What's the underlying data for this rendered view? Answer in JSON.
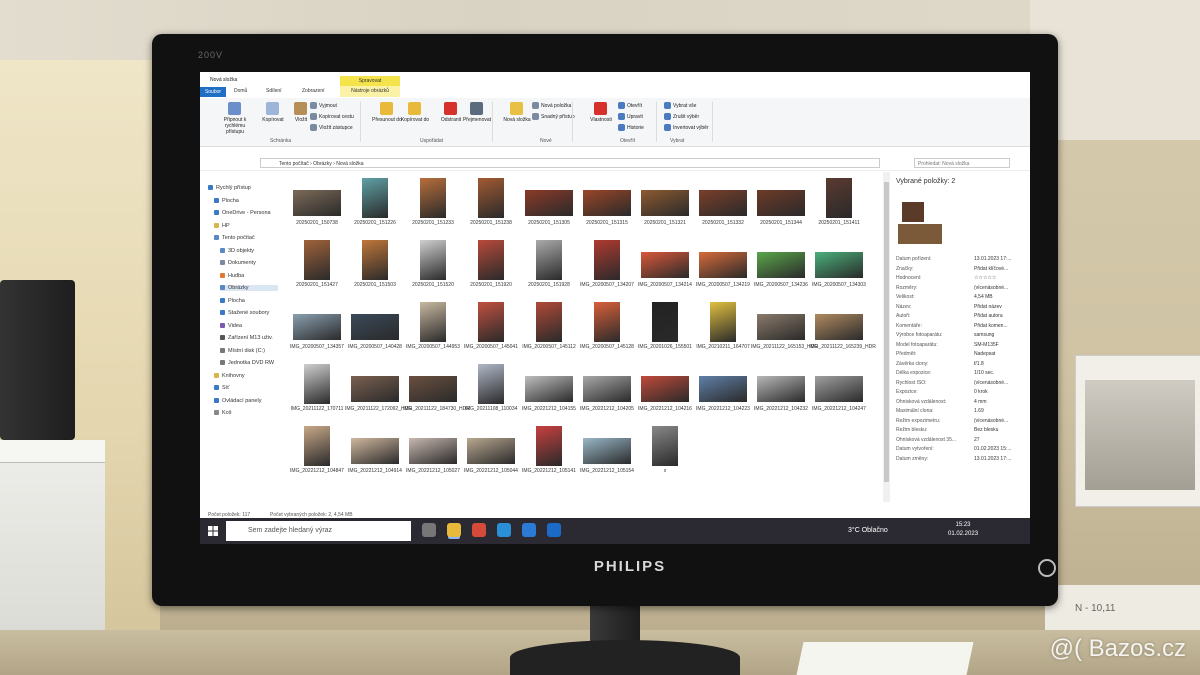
{
  "window": {
    "title": "Nová složka",
    "tools_header": "Spravovat",
    "tools_tab": "Nástroje obrázků"
  },
  "tabs": [
    "Soubor",
    "Domů",
    "Sdílení",
    "Zobrazení"
  ],
  "ribbon": {
    "buttons": [
      {
        "label": "Připnout k rychlému přístupu",
        "color": "#6a8fc9"
      },
      {
        "label": "Kopírovat",
        "color": "#9cb5d8"
      },
      {
        "label": "Vložit",
        "color": "#b58e58"
      },
      {
        "label": "Vyjmout",
        "color": "#7a8aa0"
      },
      {
        "label": "Kopírovat cestu",
        "color": "#7a8aa0"
      },
      {
        "label": "Vložit zástupce",
        "color": "#7a8aa0"
      },
      {
        "label": "Přesunout do",
        "color": "#e8b93a"
      },
      {
        "label": "Kopírovat do",
        "color": "#e8b93a"
      },
      {
        "label": "Odstranit",
        "color": "#d6322b"
      },
      {
        "label": "Přejmenovat",
        "color": "#5b6b7e"
      },
      {
        "label": "Nová složka",
        "color": "#e8c043"
      },
      {
        "label": "Nová položka",
        "color": "#7a8aa0"
      },
      {
        "label": "Snadný přístup",
        "color": "#7a8aa0"
      },
      {
        "label": "Vlastnosti",
        "color": "#d6322b"
      },
      {
        "label": "Otevřít",
        "color": "#4a7ac0"
      },
      {
        "label": "Upravit",
        "color": "#4a7ac0"
      },
      {
        "label": "Historie",
        "color": "#4a7ac0"
      },
      {
        "label": "Vybrat vše",
        "color": "#4a7ac0"
      },
      {
        "label": "Zrušit výběr",
        "color": "#4a7ac0"
      },
      {
        "label": "Invertovat výběr",
        "color": "#4a7ac0"
      }
    ],
    "groups": [
      "Schránka",
      "Uspořádat",
      "Nové",
      "Otevřít",
      "Vybrat"
    ]
  },
  "address": {
    "path": "Tento počítač  ›  Obrázky  ›  Nová složka",
    "search_placeholder": "Prohledat: Nová složka"
  },
  "nav": [
    {
      "label": "Rychlý přístup",
      "color": "#3a78c8"
    },
    {
      "label": "Plocha",
      "color": "#3a78c8"
    },
    {
      "label": "OneDrive - Persona",
      "color": "#3a78c8"
    },
    {
      "label": "HP",
      "color": "#d9b44a"
    },
    {
      "label": "Tento počítač",
      "color": "#5a88c4"
    },
    {
      "label": "3D objekty",
      "color": "#5a88c4"
    },
    {
      "label": "Dokumenty",
      "color": "#7a8aa0"
    },
    {
      "label": "Hudba",
      "color": "#e07a30"
    },
    {
      "label": "Obrázky",
      "color": "#5a88c4"
    },
    {
      "label": "Plocha",
      "color": "#3a78c8"
    },
    {
      "label": "Stažené soubory",
      "color": "#3a78c8"
    },
    {
      "label": "Videa",
      "color": "#7a5ab0"
    },
    {
      "label": "Zařízení M13 uživ.",
      "color": "#555555"
    },
    {
      "label": "Místní disk (C:)",
      "color": "#777777"
    },
    {
      "label": "Jednotka DVD RW",
      "color": "#777777"
    },
    {
      "label": "Knihovny",
      "color": "#d9b44a"
    },
    {
      "label": "Síť",
      "color": "#3a78c8"
    },
    {
      "label": "Ovládací panely",
      "color": "#3a78c8"
    },
    {
      "label": "Koš",
      "color": "#888888"
    }
  ],
  "files": [
    {
      "name": "20250201_150738",
      "color": "#7c6a58",
      "wide": true
    },
    {
      "name": "20250201_151226",
      "color": "#5fa1a6",
      "wide": false
    },
    {
      "name": "20250201_151233",
      "color": "#b86e3c",
      "wide": false
    },
    {
      "name": "20250201_151238",
      "color": "#a25a32",
      "wide": false
    },
    {
      "name": "20250201_151305",
      "color": "#8b3a28",
      "wide": true
    },
    {
      "name": "20250201_151315",
      "color": "#9a4628",
      "wide": true
    },
    {
      "name": "20250201_151321",
      "color": "#8d5a30",
      "wide": true
    },
    {
      "name": "20250201_151332",
      "color": "#7a3f2a",
      "wide": true
    },
    {
      "name": "20250201_151344",
      "color": "#6e3a28",
      "wide": true
    },
    {
      "name": "20250201_151411",
      "color": "#5a3a30",
      "wide": false
    },
    {
      "name": "20250201_151427",
      "color": "#a0623a",
      "wide": false
    },
    {
      "name": "20250201_151503",
      "color": "#c0763a",
      "wide": false
    },
    {
      "name": "20250201_151520",
      "color": "#cfcfcf",
      "wide": false
    },
    {
      "name": "20250201_151920",
      "color": "#b84a3a",
      "wide": false
    },
    {
      "name": "20250201_151928",
      "color": "#aaaaaa",
      "wide": false
    },
    {
      "name": "IMG_20200507_134207",
      "color": "#b03a30",
      "wide": false
    },
    {
      "name": "IMG_20200507_134214",
      "color": "#d9583a",
      "wide": true
    },
    {
      "name": "IMG_20200507_134219",
      "color": "#d66a3a",
      "wide": true
    },
    {
      "name": "IMG_20200507_134236",
      "color": "#5aa64a",
      "wide": true
    },
    {
      "name": "IMG_20200507_134303",
      "color": "#4ab07a",
      "wide": true
    },
    {
      "name": "IMG_20200507_134357",
      "color": "#8aa0b0",
      "wide": true
    },
    {
      "name": "IMG_20200507_140428",
      "color": "#3a4a5a",
      "wide": true
    },
    {
      "name": "IMG_20200507_144953",
      "color": "#c8b8a0",
      "wide": false
    },
    {
      "name": "IMG_20200507_145041",
      "color": "#c05040",
      "wide": false
    },
    {
      "name": "IMG_20200507_145112",
      "color": "#b04a38",
      "wide": false
    },
    {
      "name": "IMG_20200507_145128",
      "color": "#d8603a",
      "wide": false
    },
    {
      "name": "IMG_20201026_155501",
      "color": "#222222",
      "wide": false
    },
    {
      "name": "IMG_20210211_164707",
      "color": "#e0c040",
      "wide": false
    },
    {
      "name": "IMG_20211122_165153_HDR",
      "color": "#8a7a6a",
      "wide": true
    },
    {
      "name": "IMG_20211122_165239_HDR",
      "color": "#b08a60",
      "wide": true
    },
    {
      "name": "IMG_20211122_170711",
      "color": "#cfcfcf",
      "wide": false
    },
    {
      "name": "IMG_20211122_172092_HDR",
      "color": "#7a6050",
      "wide": true
    },
    {
      "name": "IMG_20211122_184730_HDR",
      "color": "#6a5040",
      "wide": true
    },
    {
      "name": "IMG_20211108_110034",
      "color": "#b0b8c8",
      "wide": false
    },
    {
      "name": "IMG_20221212_104155",
      "color": "#bfbfbf",
      "wide": true
    },
    {
      "name": "IMG_20221212_104205",
      "color": "#a8a8a8",
      "wide": true
    },
    {
      "name": "IMG_20221212_104216",
      "color": "#c04a3a",
      "wide": true
    },
    {
      "name": "IMG_20221212_104223",
      "color": "#6080a8",
      "wide": true
    },
    {
      "name": "IMG_20221212_104232",
      "color": "#b8b8b8",
      "wide": true
    },
    {
      "name": "IMG_20221212_104247",
      "color": "#a0a0a0",
      "wide": true
    },
    {
      "name": "IMG_20221212_104847",
      "color": "#c8a888",
      "wide": false
    },
    {
      "name": "IMG_20221212_104914",
      "color": "#d0b8a0",
      "wide": true
    },
    {
      "name": "IMG_20221212_105027",
      "color": "#c8b8b0",
      "wide": true
    },
    {
      "name": "IMG_20221212_105044",
      "color": "#b8a890",
      "wide": true
    },
    {
      "name": "IMG_20221212_105141",
      "color": "#c84040",
      "wide": false
    },
    {
      "name": "IMG_20221212_105154",
      "color": "#9ab8c8",
      "wide": true
    },
    {
      "name": "x",
      "color": "#888888",
      "wide": false
    }
  ],
  "details": {
    "title": "Vybrané položky: 2",
    "rows": [
      {
        "k": "Datum pořízení:",
        "v": "13.01.2023 17:..."
      },
      {
        "k": "Značky:",
        "v": "Přidat klíčové..."
      },
      {
        "k": "Hodnocení:",
        "v": "☆☆☆☆☆"
      },
      {
        "k": "Rozměry:",
        "v": "(vícenásobné..."
      },
      {
        "k": "Velikost:",
        "v": "4,54 MB"
      },
      {
        "k": "Název:",
        "v": "Přidat název"
      },
      {
        "k": "Autoři:",
        "v": "Přidat autora"
      },
      {
        "k": "Komentáře:",
        "v": "Přidat komen..."
      },
      {
        "k": "Výrobce fotoaparátu:",
        "v": "samsung"
      },
      {
        "k": "Model fotoaparátu:",
        "v": "SM-M135F"
      },
      {
        "k": "Předmět:",
        "v": "Nadepsat"
      },
      {
        "k": "Závěrka clony:",
        "v": "f/1.8"
      },
      {
        "k": "Délka expozice:",
        "v": "1/10 sec."
      },
      {
        "k": "Rychlost ISO:",
        "v": "(vícenásobné..."
      },
      {
        "k": "Expozice:",
        "v": "0 krok"
      },
      {
        "k": "Ohnisková vzdálenost:",
        "v": "4 mm"
      },
      {
        "k": "Maximální clona:",
        "v": "1.69"
      },
      {
        "k": "Režim expozimetru:",
        "v": "(vícenásobné..."
      },
      {
        "k": "Režim blesku:",
        "v": "Bez blesku"
      },
      {
        "k": "Ohnisková vzdálenost 35...",
        "v": "27"
      },
      {
        "k": "Datum vytvoření:",
        "v": "01.02.2023 15:..."
      },
      {
        "k": "Datum změny:",
        "v": "13.01.2023 17:..."
      }
    ]
  },
  "status": {
    "count": "Počet položek: 117",
    "selected": "Počet vybraných položek: 2, 4,54 MB"
  },
  "taskbar": {
    "search_placeholder": "Sem zadejte hledaný výraz",
    "weather": "3°C  Oblačno",
    "time": "15:23",
    "date": "01.02.2023",
    "icons": [
      {
        "name": "task-view-icon",
        "color": "#777"
      },
      {
        "name": "file-explorer-icon",
        "color": "#e8b93a"
      },
      {
        "name": "chrome-icon",
        "color": "#d64a3a"
      },
      {
        "name": "edge-icon",
        "color": "#2a8fd6"
      },
      {
        "name": "mail-icon",
        "color": "#2a7ad6"
      },
      {
        "name": "outlook-icon",
        "color": "#1a6ac6"
      }
    ]
  },
  "monitor": {
    "brand": "PHILIPS",
    "model": "200V"
  },
  "scene": {
    "note": "N - 10,11"
  },
  "watermark": "@( Bazos.cz"
}
